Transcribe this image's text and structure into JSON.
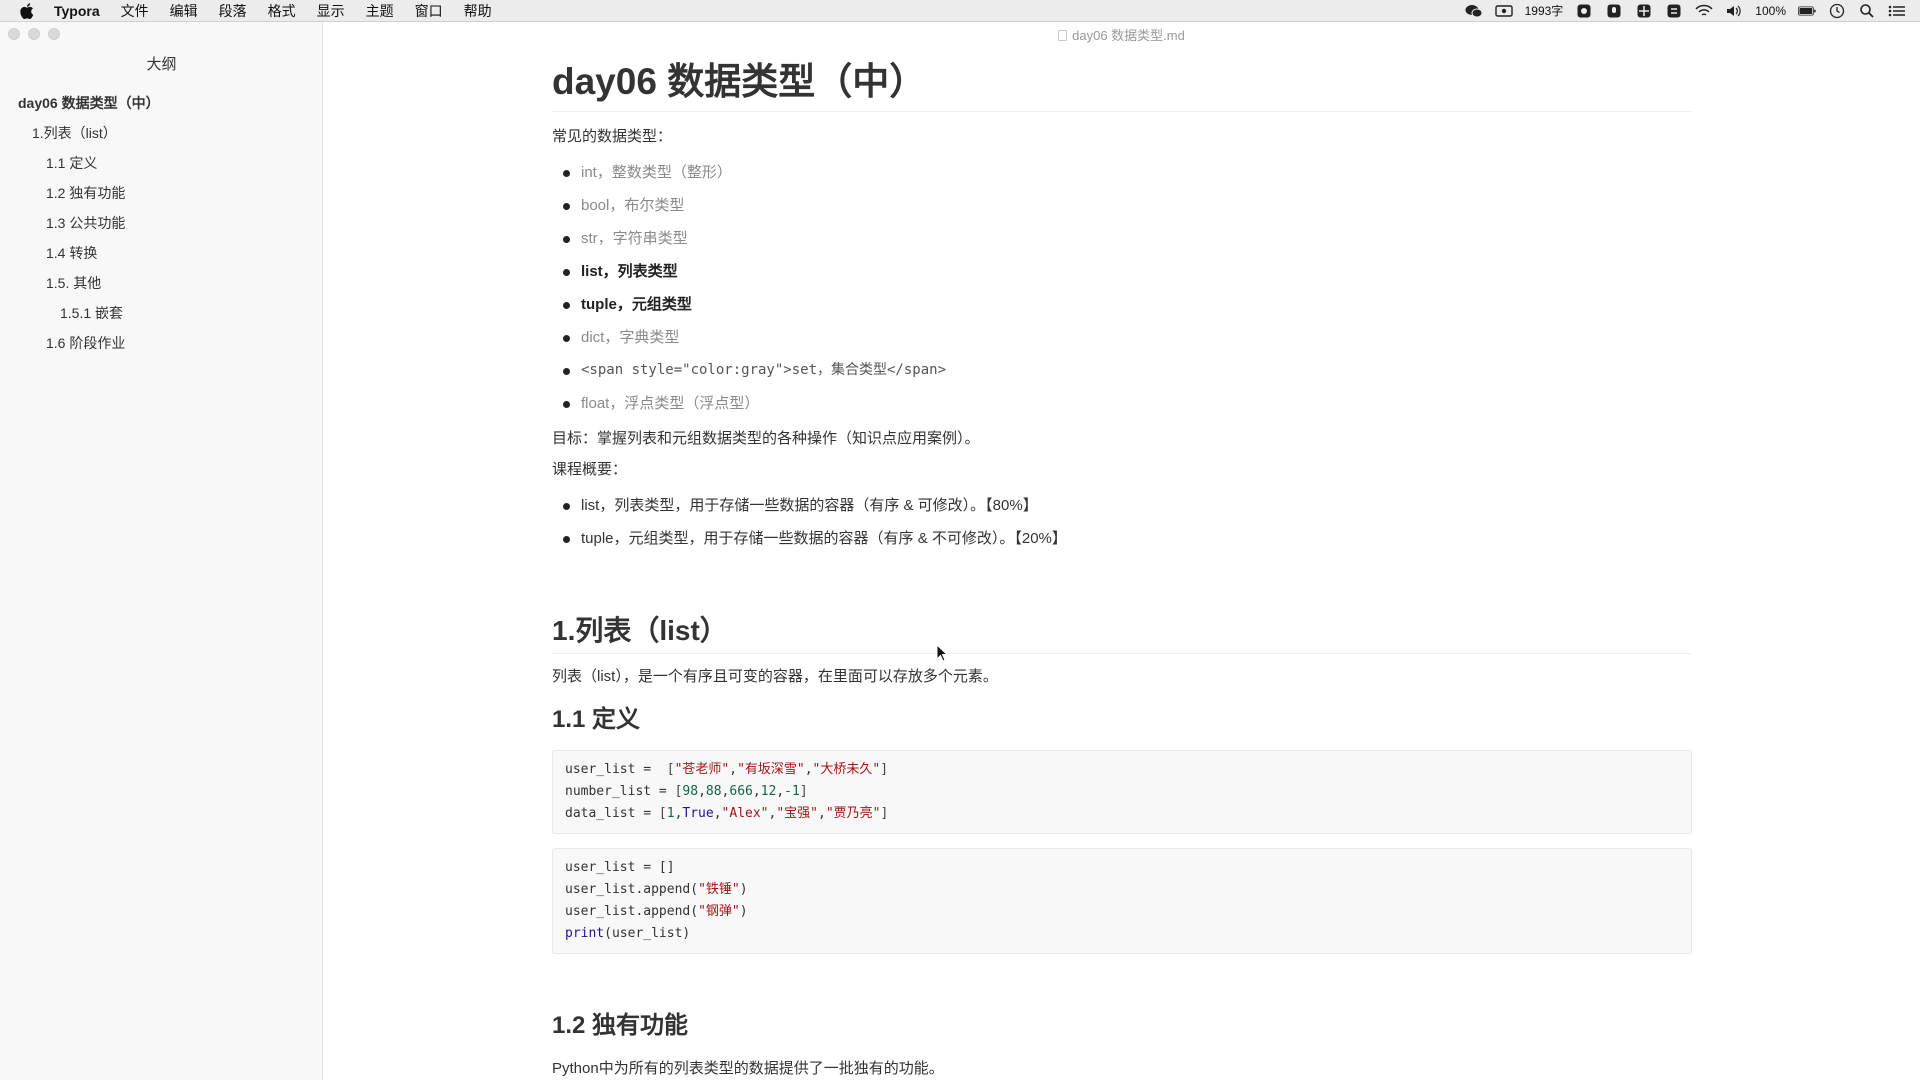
{
  "menubar": {
    "app": "Typora",
    "items": [
      "文件",
      "编辑",
      "段落",
      "格式",
      "显示",
      "主题",
      "窗口",
      "帮助"
    ],
    "word_count": "1993字",
    "battery": "100%"
  },
  "sidebar": {
    "title": "大纲",
    "outline": [
      {
        "label": "day06 数据类型（中）",
        "level": 1
      },
      {
        "label": "1.列表（list）",
        "level": 2
      },
      {
        "label": "1.1 定义",
        "level": 3
      },
      {
        "label": "1.2 独有功能",
        "level": 3
      },
      {
        "label": "1.3 公共功能",
        "level": 3
      },
      {
        "label": "1.4 转换",
        "level": 3
      },
      {
        "label": "1.5. 其他",
        "level": 3
      },
      {
        "label": "1.5.1 嵌套",
        "level": 4
      },
      {
        "label": "1.6 阶段作业",
        "level": 3
      }
    ]
  },
  "document": {
    "filename": "day06 数据类型.md",
    "title": "day06 数据类型（中）",
    "intro": "常见的数据类型：",
    "types": [
      {
        "text": "int，整数类型（整形）",
        "style": "gray"
      },
      {
        "text": "bool，布尔类型",
        "style": "gray"
      },
      {
        "text": "str，字符串类型",
        "style": "gray"
      },
      {
        "text": "list，列表类型",
        "style": "bold"
      },
      {
        "text": "tuple，元组类型",
        "style": "bold"
      },
      {
        "text": "dict，字典类型",
        "style": "gray"
      },
      {
        "text": "<span style=\"color:gray\">set，集合类型</span>",
        "style": "raw"
      },
      {
        "text": "float，浮点类型（浮点型）",
        "style": "gray"
      }
    ],
    "goal": "目标：掌握列表和元组数据类型的各种操作（知识点应用案例）。",
    "overview_label": "课程概要：",
    "overview": [
      "list，列表类型，用于存储一些数据的容器（有序 & 可修改）。【80%】",
      "tuple，元组类型，用于存储一些数据的容器（有序 & 不可修改）。【20%】"
    ],
    "section1_title": "1.列表（list）",
    "section1_desc": "列表（list），是一个有序且可变的容器，在里面可以存放多个元素。",
    "sub11_title": "1.1 定义",
    "code1": [
      "user_list =  [\"苍老师\",\"有坂深雪\",\"大桥未久\"]",
      "number_list = [98,88,666,12,-1]",
      "data_list = [1,True,\"Alex\",\"宝强\",\"贾乃亮\"]"
    ],
    "code2": [
      "user_list = []",
      "user_list.append(\"铁锤\")",
      "user_list.append(\"钢弹\")",
      "print(user_list)"
    ],
    "sub12_title": "1.2 独有功能",
    "sub12_desc": "Python中为所有的列表类型的数据提供了一批独有的功能。"
  }
}
